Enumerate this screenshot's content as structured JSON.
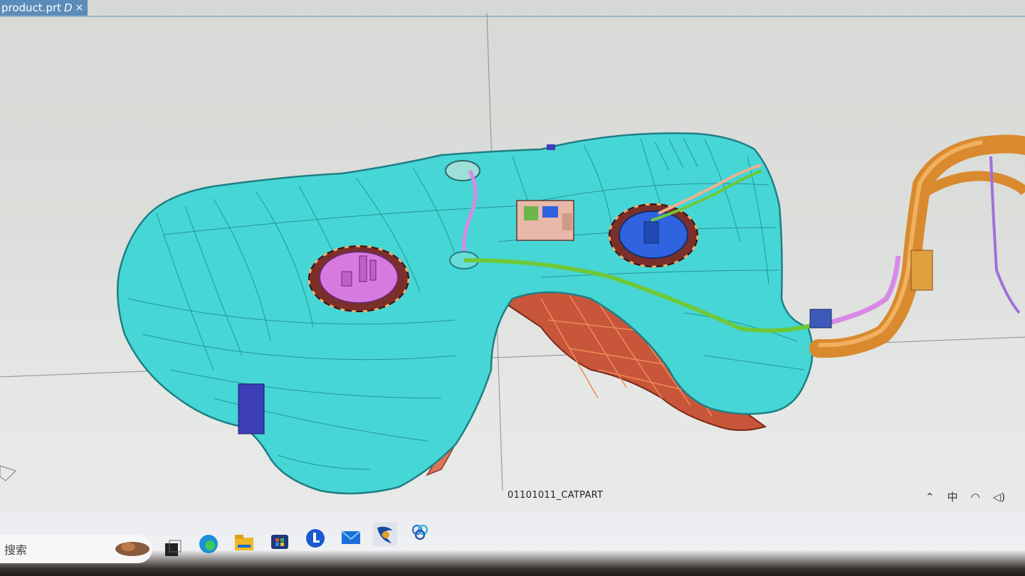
{
  "window": {
    "tab_title": "product.prt",
    "tab_mark": "D",
    "close_glyph": "×"
  },
  "viewport": {
    "part_name": "01101011_CATPART",
    "colors": {
      "tank": "#46d6d6",
      "tank_edge": "#2a8e92",
      "pump_left": "#d77ae0",
      "pump_right": "#2f63e0",
      "flange": "#7a2f2a",
      "heat_shield": "#c8563a",
      "filler_pipe": "#d98a2e",
      "hose_green": "#6ec83a",
      "hose_pink": "#d889e6",
      "strap": "#3c3fb8"
    }
  },
  "taskbar": {
    "search_label": "搜索",
    "tray_ime": "中",
    "icons": [
      "weather-icon",
      "task-view-icon",
      "edge-browser-icon",
      "file-explorer-icon",
      "store-icon",
      "app-l-icon",
      "mail-icon",
      "catia-icon",
      "app-circles-icon"
    ]
  }
}
